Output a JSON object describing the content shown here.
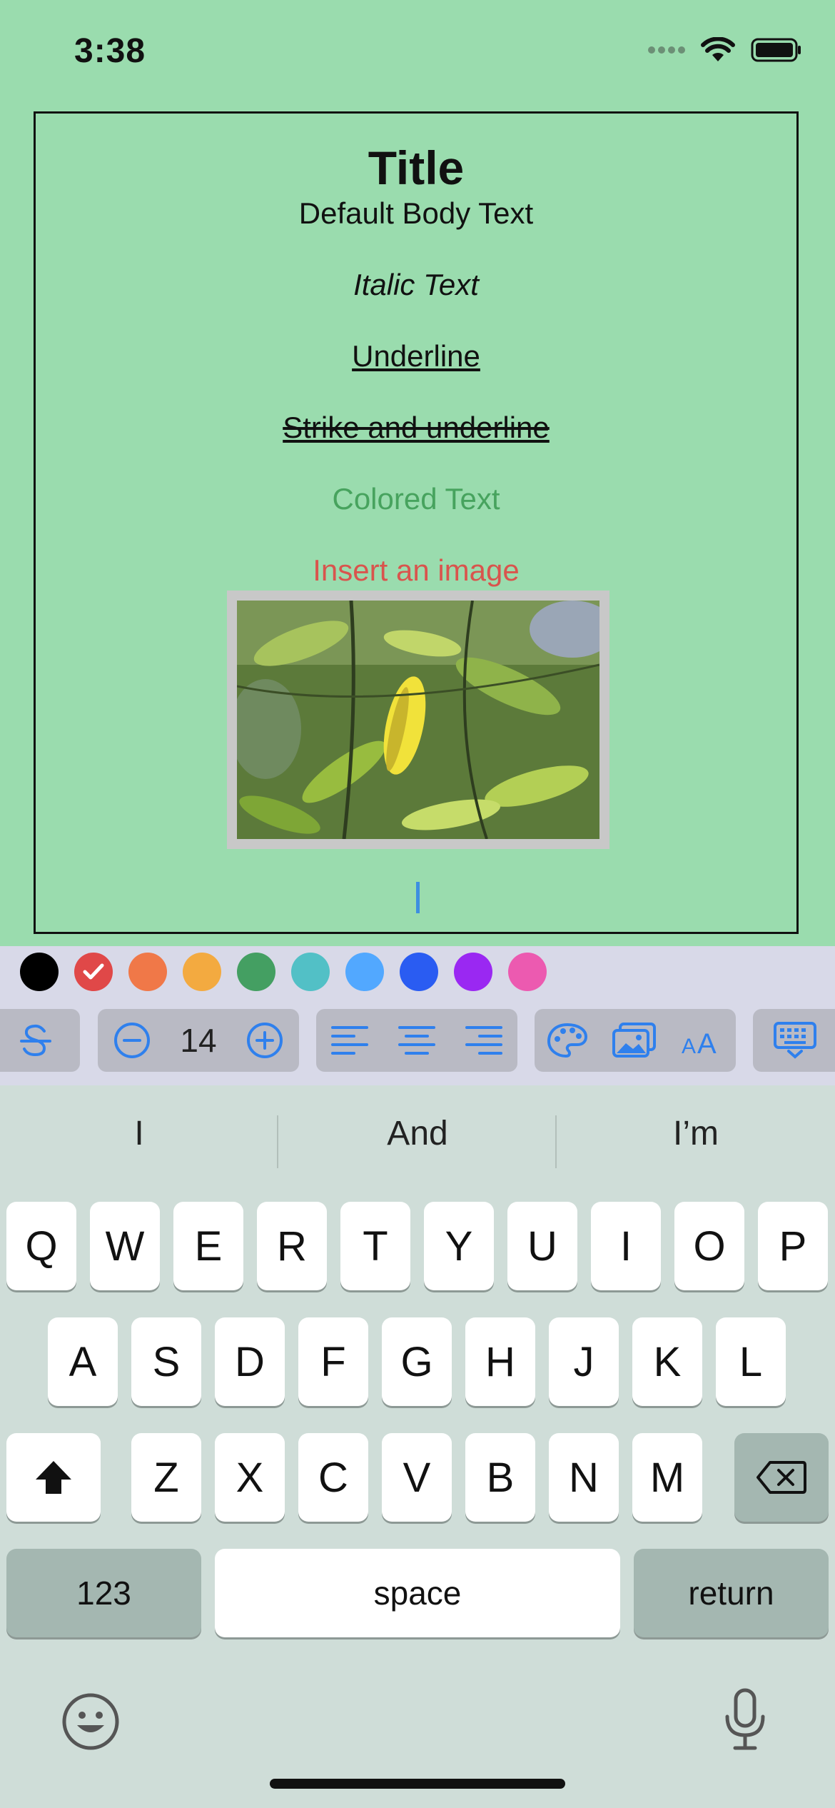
{
  "status": {
    "time": "3:38"
  },
  "editor": {
    "title": "Title",
    "body": "Default Body Text",
    "italic": "Italic Text",
    "underline": "Underline",
    "strike": "Strike and underline",
    "colored": "Colored Text",
    "insert_prompt": "Insert an image"
  },
  "toolbar": {
    "colors": [
      "#000000",
      "#e04848",
      "#f07848",
      "#f3aa40",
      "#449f62",
      "#52c0c6",
      "#52a8ff",
      "#2a5cf2",
      "#9a28f2",
      "#ec5ab0"
    ],
    "selected_color": "#e04848",
    "font_size": "14"
  },
  "keyboard": {
    "suggestions": [
      "I",
      "And",
      "I’m"
    ],
    "row1": [
      "Q",
      "W",
      "E",
      "R",
      "T",
      "Y",
      "U",
      "I",
      "O",
      "P"
    ],
    "row2": [
      "A",
      "S",
      "D",
      "F",
      "G",
      "H",
      "J",
      "K",
      "L"
    ],
    "row3": [
      "Z",
      "X",
      "C",
      "V",
      "B",
      "N",
      "M"
    ],
    "numbers_label": "123",
    "space_label": "space",
    "return_label": "return"
  }
}
